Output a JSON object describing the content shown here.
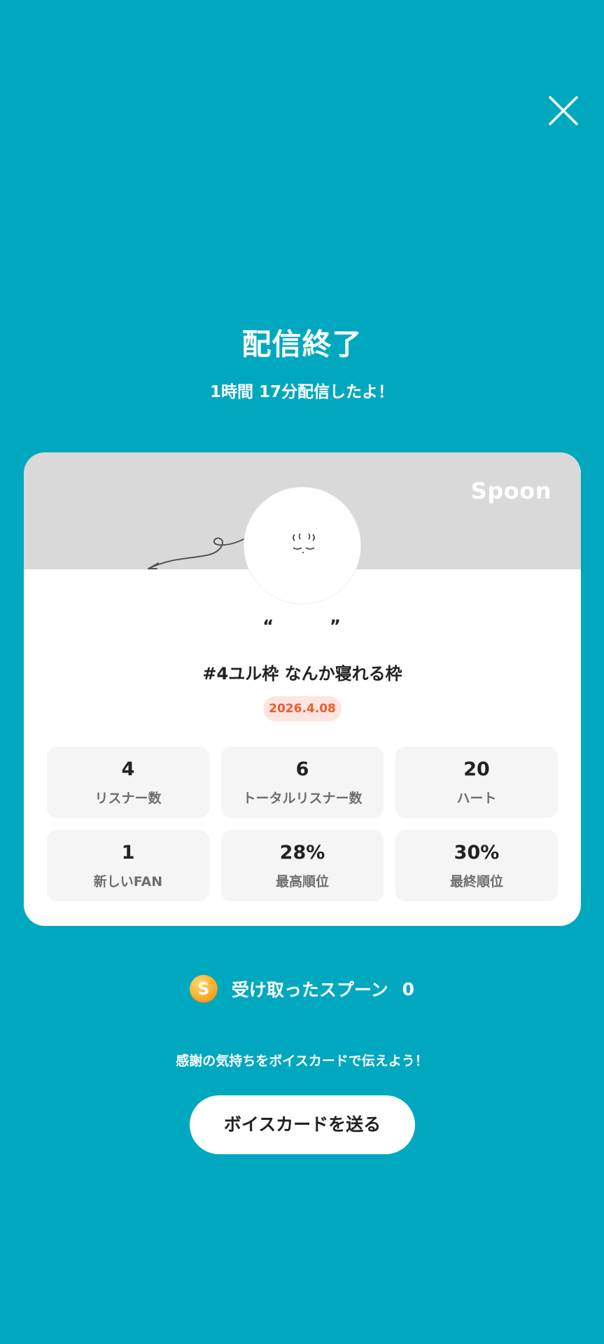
{
  "header": {
    "close_icon": "close-icon"
  },
  "summary": {
    "title": "配信終了",
    "duration_text": "1時間 17分配信したよ！"
  },
  "card": {
    "brand": "Spoon",
    "nickname": "“　　　”",
    "live_title": "#4ユル枠 なんか寝れる枠",
    "date": "2026.4.08",
    "colors": {
      "banner": "#d9d9d9",
      "badge_bg": "#fde6df",
      "badge_text": "#ef5a2e"
    },
    "stats": [
      {
        "value": "4",
        "label": "リスナー数"
      },
      {
        "value": "6",
        "label": "トータルリスナー数"
      },
      {
        "value": "20",
        "label": "ハート"
      },
      {
        "value": "1",
        "label": "新しいFAN"
      },
      {
        "value": "28%",
        "label": "最高順位"
      },
      {
        "value": "30%",
        "label": "最終順位"
      }
    ]
  },
  "spoons": {
    "coin_symbol": "S",
    "label": "受け取ったスプーン",
    "count": "0"
  },
  "footer": {
    "thanks_text": "感謝の気持ちをボイスカードで伝えよう！",
    "button_label": "ボイスカードを送る"
  },
  "theme": {
    "background": "#00a8bf",
    "coin": "#f9b234"
  }
}
